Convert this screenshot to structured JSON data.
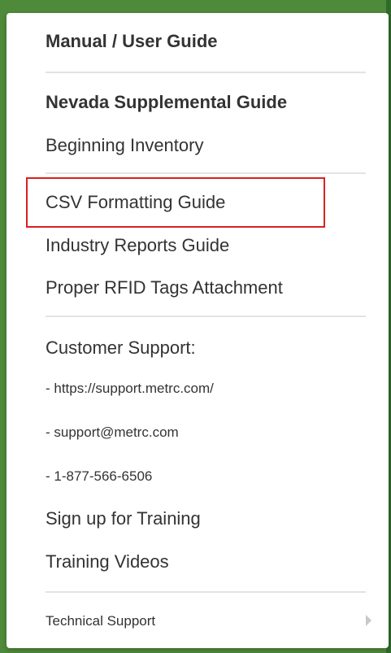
{
  "menu": {
    "manual": "Manual / User Guide",
    "nevada": "Nevada Supplemental Guide",
    "beginning_inventory": "Beginning Inventory",
    "csv_guide": "CSV Formatting Guide",
    "industry_reports": "Industry Reports Guide",
    "rfid": "Proper RFID Tags Attachment",
    "customer_support": "Customer Support:",
    "support_url": "- https://support.metrc.com/",
    "support_email": "- support@metrc.com",
    "support_phone": "- 1-877-566-6506",
    "training_signup": "Sign up for Training",
    "training_videos": "Training Videos",
    "technical_support": "Technical Support"
  },
  "icons": {
    "submenu": "chevron-right-icon"
  },
  "colors": {
    "highlight": "#d9201f",
    "frame": "#4f8a3a"
  }
}
